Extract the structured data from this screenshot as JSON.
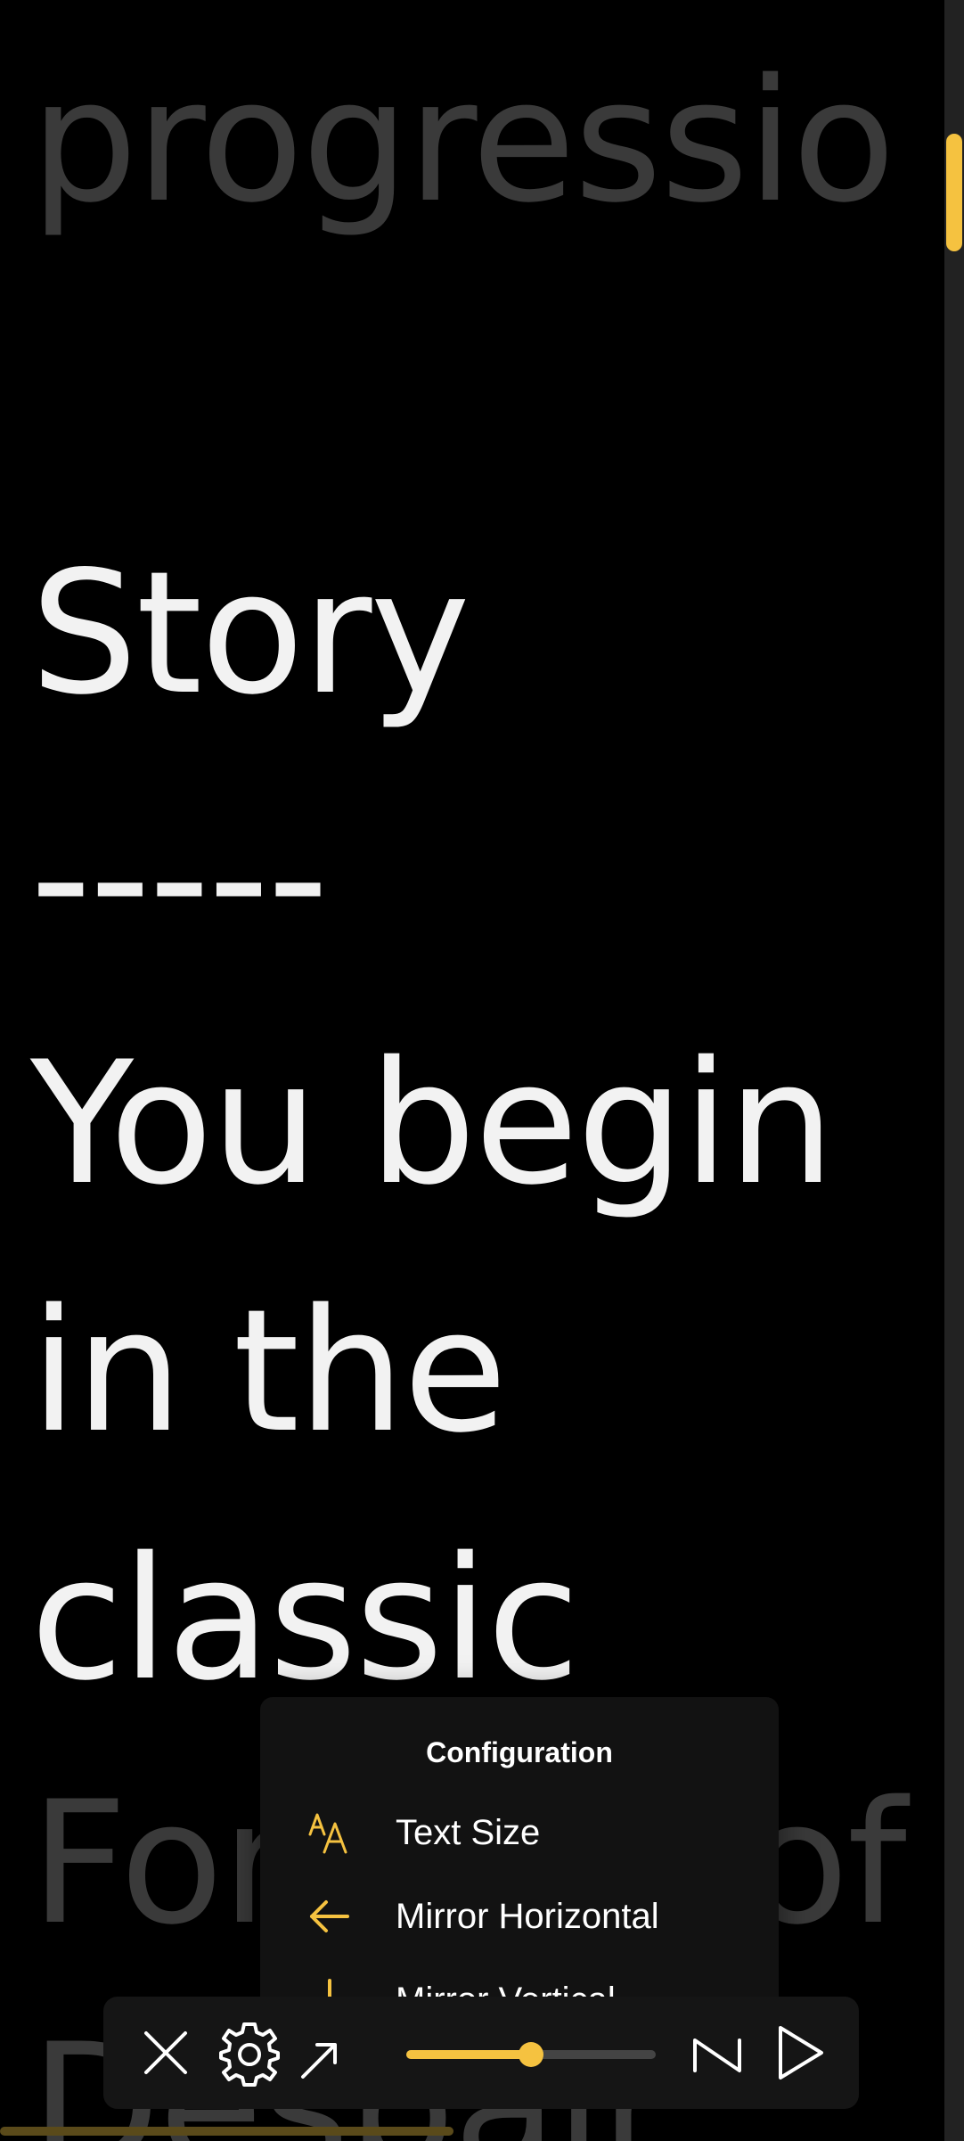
{
  "script_lines": [
    {
      "text": "progressio",
      "state": "dim"
    },
    {
      "text": "Story",
      "state": "bright"
    },
    {
      "text": "-----",
      "state": "bright"
    },
    {
      "text": "You begin",
      "state": "bright"
    },
    {
      "text": "in the",
      "state": "bright"
    },
    {
      "text": "classic",
      "state": "bright"
    },
    {
      "text": "Fortress of",
      "state": "dim"
    },
    {
      "text": "Despair",
      "state": "dim"
    }
  ],
  "config_menu": {
    "title": "Configuration",
    "items": [
      {
        "label": "Text Size",
        "icon": "text-size-icon"
      },
      {
        "label": "Mirror Horizontal",
        "icon": "arrow-left-icon"
      },
      {
        "label": "Mirror Vertical",
        "icon": "arrow-down-icon"
      }
    ]
  },
  "toolbar": {
    "close_icon": "close-icon",
    "settings_icon": "gear-icon",
    "expand_icon": "expand-icon",
    "flip_icon": "flip-icon",
    "play_icon": "play-icon",
    "speed_level": 0.5
  },
  "scroll_progress": 0.48,
  "colors": {
    "accent": "#f5c240",
    "background": "#000000",
    "text_bright": "#f2f2f2",
    "text_dim": "#3a3a3a"
  }
}
